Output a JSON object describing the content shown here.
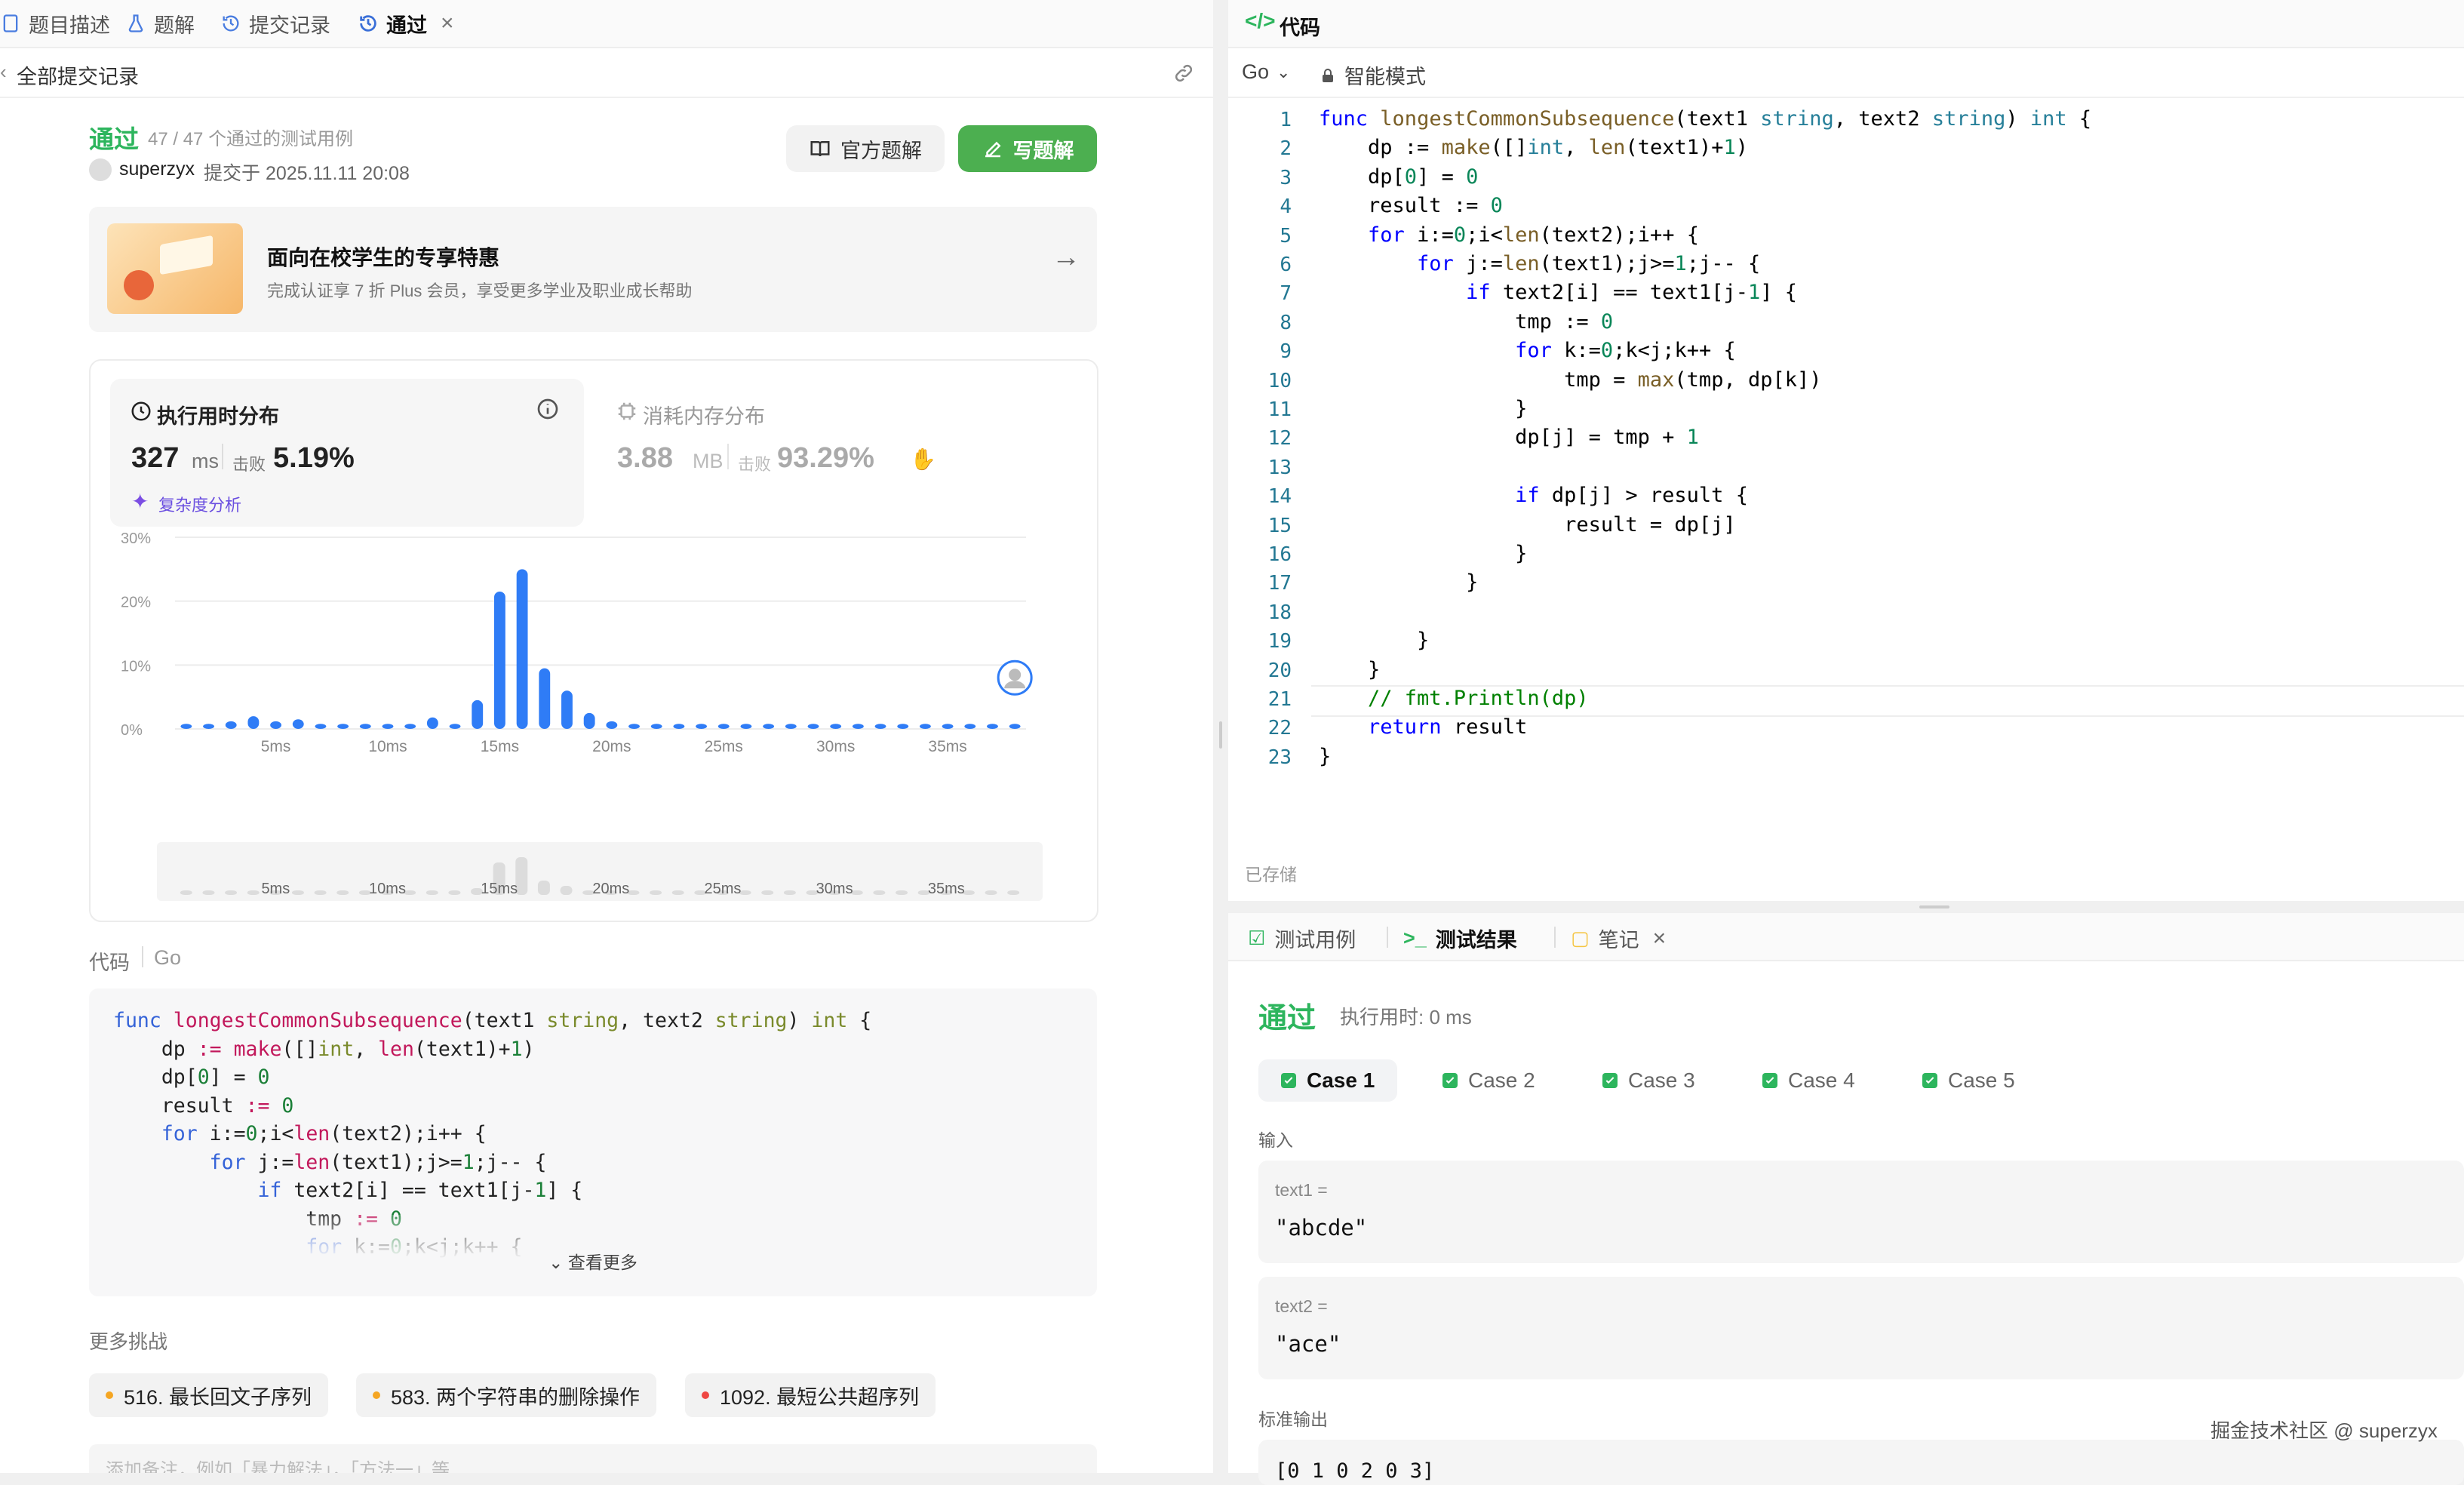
{
  "left_tabs": [
    {
      "label": "题目描述",
      "icon": "document-icon"
    },
    {
      "label": "题解",
      "icon": "flask-icon"
    },
    {
      "label": "提交记录",
      "icon": "history-icon"
    },
    {
      "label": "通过",
      "icon": "history-icon"
    }
  ],
  "all_submissions": "全部提交记录",
  "submission": {
    "status": "通过",
    "passed_text": "47 / 47 个通过的测试用例",
    "user": "superzyx",
    "submitted_at": "提交于 2025.11.11 20:08",
    "official_btn": "官方题解",
    "write_btn": "写题解"
  },
  "promo": {
    "title": "面向在校学生的专享特惠",
    "subtitle": "完成认证享 7 折 Plus 会员，享受更多学业及职业成长帮助"
  },
  "runtime": {
    "title": "执行用时分布",
    "value": "327",
    "unit": "ms",
    "beats_label": "击败",
    "beats": "5.19%",
    "analysis": "复杂度分析"
  },
  "memory": {
    "title": "消耗内存分布",
    "value": "3.88",
    "unit": "MB",
    "beats_label": "击败",
    "beats": "93.29%"
  },
  "chart_data": {
    "type": "bar",
    "title": "执行用时分布",
    "xlabel": "",
    "ylabel": "",
    "ylim": [
      0,
      30
    ],
    "y_ticks": [
      "0%",
      "10%",
      "20%",
      "30%"
    ],
    "x_tick_labels": [
      "5ms",
      "10ms",
      "15ms",
      "20ms",
      "25ms",
      "30ms",
      "35ms"
    ],
    "x_tick_values": [
      5,
      10,
      15,
      20,
      25,
      30,
      35
    ],
    "x": [
      1,
      2,
      3,
      4,
      5,
      6,
      7,
      8,
      9,
      10,
      11,
      12,
      13,
      14,
      15,
      16,
      17,
      18,
      19,
      20,
      21,
      22,
      23,
      24,
      25,
      26,
      27,
      28,
      29,
      30,
      31,
      32,
      33,
      34,
      35,
      36,
      37,
      38
    ],
    "values": [
      0.8,
      0.8,
      1.2,
      2,
      1.2,
      1.5,
      0.8,
      0.8,
      0.8,
      0.8,
      0.8,
      1.8,
      0.8,
      4.5,
      21.5,
      25,
      9.5,
      6,
      2.5,
      1.2,
      0.8,
      0.8,
      0.8,
      0.8,
      0.8,
      0.8,
      0.8,
      0.8,
      0.8,
      0.8,
      0.8,
      0.8,
      0.8,
      0.8,
      0.8,
      0.8,
      0.8,
      0.8
    ],
    "highlight_x": 38,
    "grid": true,
    "mini_ticks": [
      "5ms",
      "10ms",
      "15ms",
      "20ms",
      "25ms",
      "30ms",
      "35ms"
    ]
  },
  "code_section": {
    "label": "代码",
    "lang": "Go",
    "more": "查看更多"
  },
  "more_challenges": {
    "title": "更多挑战",
    "items": [
      {
        "label": "516. 最长回文子序列",
        "color": "#f5a623"
      },
      {
        "label": "583. 两个字符串的删除操作",
        "color": "#f5a623"
      },
      {
        "label": "1092. 最短公共超序列",
        "color": "#ef4743"
      }
    ]
  },
  "note_placeholder": "添加备注，例如「暴力解法」，「方法一」等",
  "editor": {
    "title": "代码",
    "lang": "Go",
    "mode": "智能模式",
    "saved": "已存储",
    "lines": [
      "func longestCommonSubsequence(text1 string, text2 string) int {",
      "    dp := make([]int, len(text1)+1)",
      "    dp[0] = 0",
      "    result := 0",
      "    for i:=0;i<len(text2);i++ {",
      "        for j:=len(text1);j>=1;j-- {",
      "            if text2[i] == text1[j-1] {",
      "                tmp := 0",
      "                for k:=0;k<j;k++ {",
      "                    tmp = max(tmp, dp[k])",
      "                }",
      "                dp[j] = tmp + 1",
      "",
      "                if dp[j] > result {",
      "                    result = dp[j]",
      "                }",
      "            }",
      "",
      "        }",
      "    }",
      "    // fmt.Println(dp)",
      "    return result",
      "}"
    ]
  },
  "results": {
    "tabs": [
      "测试用例",
      "测试结果",
      "笔记"
    ],
    "status": "通过",
    "runtime": "执行用时: 0 ms",
    "cases": [
      "Case 1",
      "Case 2",
      "Case 3",
      "Case 4",
      "Case 5"
    ],
    "input_label": "输入",
    "inputs": [
      {
        "name": "text1 =",
        "value": "\"abcde\""
      },
      {
        "name": "text2 =",
        "value": "\"ace\""
      }
    ],
    "output_label": "标准输出",
    "output_value": "[0 1 0 2 0 3]"
  },
  "watermark": "掘金技术社区 @ superzyx",
  "colors": {
    "accent_green": "#2db55d",
    "bar_blue": "#2f7cf6",
    "brand_green": "#4caf50"
  }
}
